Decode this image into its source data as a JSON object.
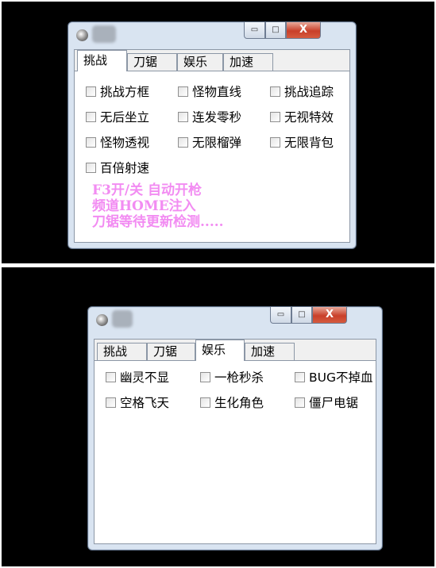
{
  "window1": {
    "tabs": [
      "挑战",
      "刀锯",
      "娱乐",
      "加速"
    ],
    "active_tab": "挑战",
    "checkboxes": [
      "挑战方框",
      "怪物直线",
      "挑战追踪",
      "无后坐立",
      "连发零秒",
      "无视特效",
      "怪物透视",
      "无限榴弹",
      "无限背包",
      "百倍射速"
    ],
    "notes": [
      "F3开/关 自动开枪",
      "频道HOME注入",
      "刀锯等待更新检测....."
    ],
    "note_color": "#f28cf2"
  },
  "window2": {
    "tabs": [
      "挑战",
      "刀锯",
      "娱乐",
      "加速"
    ],
    "active_tab": "娱乐",
    "checkboxes": [
      "幽灵不显",
      "一枪秒杀",
      "BUG不掉血",
      "空格飞天",
      "生化角色",
      "僵尸电锯"
    ]
  },
  "controls": {
    "minimize": "▭",
    "maximize": "□",
    "close": "X"
  },
  "icons": {
    "app": "app-icon",
    "title_blurred": "title-blur"
  }
}
